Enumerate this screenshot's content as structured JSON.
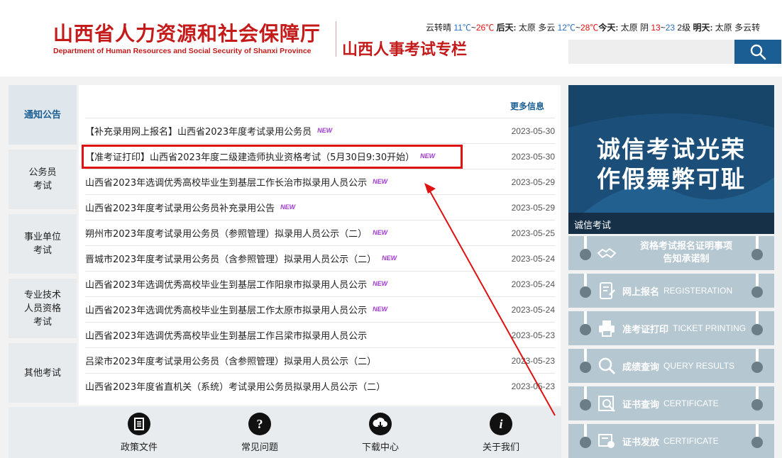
{
  "header": {
    "logo_cn": "山西省人力资源和社会保障厅",
    "logo_en": "Department of Human Resources and Social Security of Shanxi Province",
    "subtitle": "山西人事考试专栏",
    "weather": {
      "p1": "云转晴",
      "p1_low": "11℃",
      "p1_sep": "~",
      "p1_high": "26℃",
      "d2_label": "后天:",
      "d2_city": "太原 多云",
      "d2_low": "12℃",
      "d2_sep": "~",
      "d2_high": "28℃",
      "d0_label": "今天:",
      "d0_city": "太原 阴",
      "d0_low": "13",
      "d0_sep": "~",
      "d0_high": "23",
      "d0_wind": "2级",
      "d1_label": "明天:",
      "d1_city": "太原 多云转"
    },
    "search_placeholder": ""
  },
  "tabs": [
    {
      "label": "通知公告"
    },
    {
      "label": "公务员\n考试"
    },
    {
      "label": "事业单位\n考试"
    },
    {
      "label": "专业技术\n人员资格\n考试"
    },
    {
      "label": "其他考试"
    }
  ],
  "news": {
    "more": "更多信息",
    "new_badge": "NEW",
    "items": [
      {
        "title": "【补充录用网上报名】山西省2023年度考试录用公务员",
        "date": "2023-05-30",
        "is_new": true
      },
      {
        "title": "【准考证打印】山西省2023年度二级建造师执业资格考试（5月30日9:30开始）",
        "date": "2023-05-30",
        "is_new": true
      },
      {
        "title": "山西省2023年选调优秀高校毕业生到基层工作长治市拟录用人员公示",
        "date": "2023-05-29",
        "is_new": true
      },
      {
        "title": "山西省2023年度考试录用公务员补充录用公告",
        "date": "2023-05-29",
        "is_new": true
      },
      {
        "title": "朔州市2023年度考试录用公务员（参照管理）拟录用人员公示（二）",
        "date": "2023-05-25",
        "is_new": true
      },
      {
        "title": "晋城市2023年度考试录用公务员（含参照管理）拟录用人员公示（二）",
        "date": "2023-05-24",
        "is_new": true
      },
      {
        "title": "山西省2023年选调优秀高校毕业生到基层工作阳泉市拟录用人员公示",
        "date": "2023-05-24",
        "is_new": true
      },
      {
        "title": "山西省2023年选调优秀高校毕业生到基层工作太原市拟录用人员公示",
        "date": "2023-05-24",
        "is_new": true
      },
      {
        "title": "山西省2023年选调优秀高校毕业生到基层工作吕梁市拟录用人员公示",
        "date": "2023-05-23",
        "is_new": false
      },
      {
        "title": "吕梁市2023年度考试录用公务员（含参照管理）拟录用人员公示（二）",
        "date": "2023-05-23",
        "is_new": false
      },
      {
        "title": "山西省2023年度省直机关（系统）考试录用公务员拟录用人员公示（二）",
        "date": "2023-05-23",
        "is_new": false
      }
    ]
  },
  "shortcuts": [
    {
      "label": "政策文件",
      "icon": "document-icon"
    },
    {
      "label": "常见问题",
      "icon": "question-icon"
    },
    {
      "label": "下载中心",
      "icon": "download-icon"
    },
    {
      "label": "关于我们",
      "icon": "info-icon"
    }
  ],
  "banner": {
    "line1": "诚信考试光荣",
    "line2": "作假舞弊可耻",
    "caption": "诚信考试",
    "bg_color": "#1b4f7a"
  },
  "side_buttons": [
    {
      "cn": "资格考试报名证明事项",
      "cn2": "告知承诺制",
      "en": "",
      "icon": "handshake-icon"
    },
    {
      "cn": "网上报名",
      "en": "REGISTERATION",
      "icon": "form-icon"
    },
    {
      "cn": "准考证打印",
      "en": "TICKET PRINTING",
      "icon": "printer-icon"
    },
    {
      "cn": "成绩查询",
      "en": "QUERY RESULTS",
      "icon": "magnifier-icon"
    },
    {
      "cn": "证书查询",
      "en": "CERTIFICATE",
      "icon": "certificate-search-icon"
    },
    {
      "cn": "证书发放",
      "en": "CERTIFICATE",
      "icon": "certificate-issue-icon"
    }
  ],
  "colors": {
    "brand_red": "#c41a1a",
    "brand_blue": "#1b5e93",
    "highlight": "#e01111"
  }
}
